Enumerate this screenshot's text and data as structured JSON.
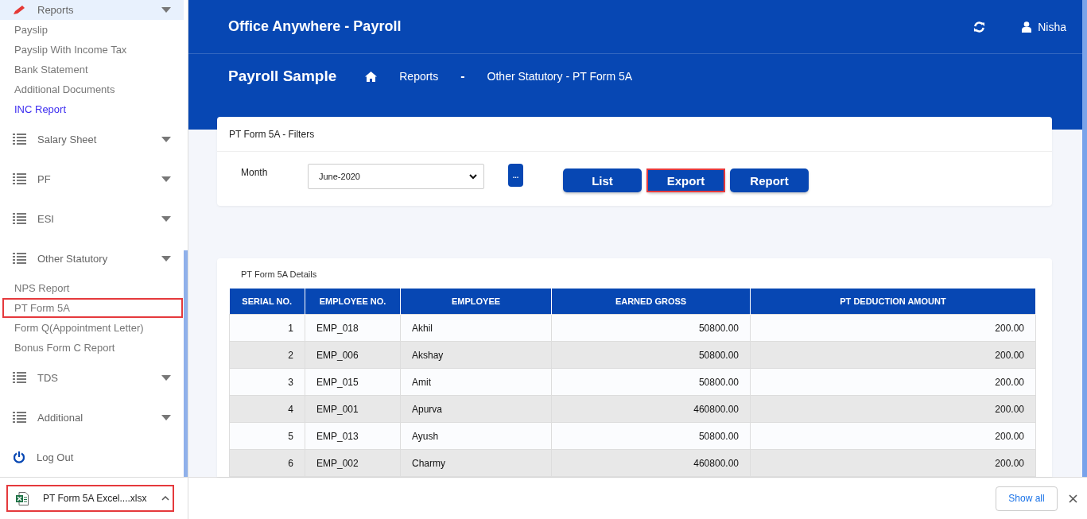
{
  "sidebar": {
    "items": [
      {
        "kind": "group",
        "label": "Reports",
        "hovered": true,
        "annotated": false,
        "children": [
          {
            "label": "Payslip",
            "active": false,
            "annotated": false
          },
          {
            "label": "Payslip With Income Tax",
            "active": false,
            "annotated": false
          },
          {
            "label": "Bank Statement",
            "active": false,
            "annotated": false
          },
          {
            "label": "Additional Documents",
            "active": false,
            "annotated": false
          },
          {
            "label": "INC Report",
            "active": true,
            "annotated": false
          }
        ]
      },
      {
        "kind": "group",
        "label": "Salary Sheet",
        "hovered": false,
        "annotated": false
      },
      {
        "kind": "group",
        "label": "PF",
        "hovered": false,
        "annotated": false
      },
      {
        "kind": "group",
        "label": "ESI",
        "hovered": false,
        "annotated": false
      },
      {
        "kind": "group",
        "label": "Other Statutory",
        "hovered": false,
        "annotated": false,
        "children": [
          {
            "label": "NPS Report",
            "active": false,
            "annotated": false
          },
          {
            "label": "PT Form 5A",
            "active": false,
            "annotated": true
          },
          {
            "label": "Form Q(Appointment Letter)",
            "active": false,
            "annotated": false
          },
          {
            "label": "Bonus Form C Report",
            "active": false,
            "annotated": false
          }
        ]
      },
      {
        "kind": "group",
        "label": "TDS",
        "hovered": false,
        "annotated": false
      },
      {
        "kind": "group",
        "label": "Additional",
        "hovered": false,
        "annotated": false
      },
      {
        "kind": "logout",
        "label": "Log Out",
        "annotated": false
      }
    ]
  },
  "header": {
    "title": "Office Anywhere - Payroll",
    "user": "Nisha",
    "company": "Payroll Sample",
    "breadcrumb": [
      "Reports",
      "-",
      "Other Statutory - PT Form 5A"
    ]
  },
  "filters": {
    "title": "PT Form 5A - Filters",
    "month_label": "Month",
    "month_value": "June-2020",
    "more_button": "...",
    "buttons": [
      {
        "label": "List",
        "annotated": false
      },
      {
        "label": "Export",
        "annotated": true
      },
      {
        "label": "Report",
        "annotated": false
      }
    ]
  },
  "details": {
    "title": "PT Form 5A Details",
    "table": {
      "columns": [
        "SERIAL NO.",
        "EMPLOYEE NO.",
        "EMPLOYEE",
        "EARNED GROSS",
        "PT DEDUCTION AMOUNT"
      ],
      "rows": [
        [
          "1",
          "EMP_018",
          "Akhil",
          "50800.00",
          "200.00"
        ],
        [
          "2",
          "EMP_006",
          "Akshay",
          "50800.00",
          "200.00"
        ],
        [
          "3",
          "EMP_015",
          "Amit",
          "50800.00",
          "200.00"
        ],
        [
          "4",
          "EMP_001",
          "Apurva",
          "460800.00",
          "200.00"
        ],
        [
          "5",
          "EMP_013",
          "Ayush",
          "50800.00",
          "200.00"
        ],
        [
          "6",
          "EMP_002",
          "Charmy",
          "460800.00",
          "200.00"
        ]
      ]
    }
  },
  "download_bar": {
    "file": {
      "name": "PT Form 5A Excel....xlsx",
      "annotated": true
    },
    "show_all": "Show all"
  }
}
